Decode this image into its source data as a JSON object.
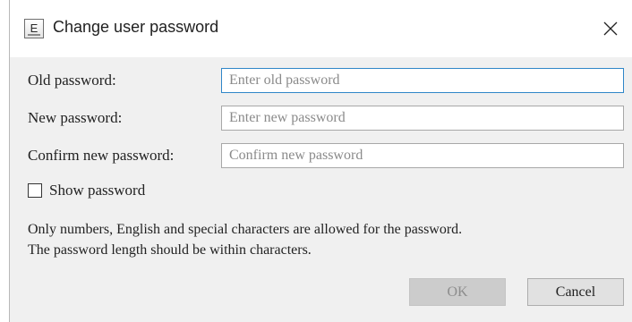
{
  "dialog": {
    "title": "Change user password",
    "app_icon_letter": "E",
    "close_icon": "close-icon"
  },
  "fields": [
    {
      "label": "Old password:",
      "placeholder": "Enter old password",
      "value": "",
      "focused": true
    },
    {
      "label": "New password:",
      "placeholder": "Enter new password",
      "value": "",
      "focused": false
    },
    {
      "label": "Confirm new password:",
      "placeholder": "Confirm new password",
      "value": "",
      "focused": false
    }
  ],
  "show_password": {
    "label": "Show password",
    "checked": false
  },
  "notes": {
    "line1": "Only numbers, English and special characters are allowed for the password.",
    "line2": "The password length should be within characters."
  },
  "buttons": {
    "ok_label": "OK",
    "ok_enabled": false,
    "cancel_label": "Cancel"
  },
  "colors": {
    "focus_border": "#2f86c8",
    "dialog_background": "#f0f0f0",
    "title_background": "#ffffff"
  }
}
